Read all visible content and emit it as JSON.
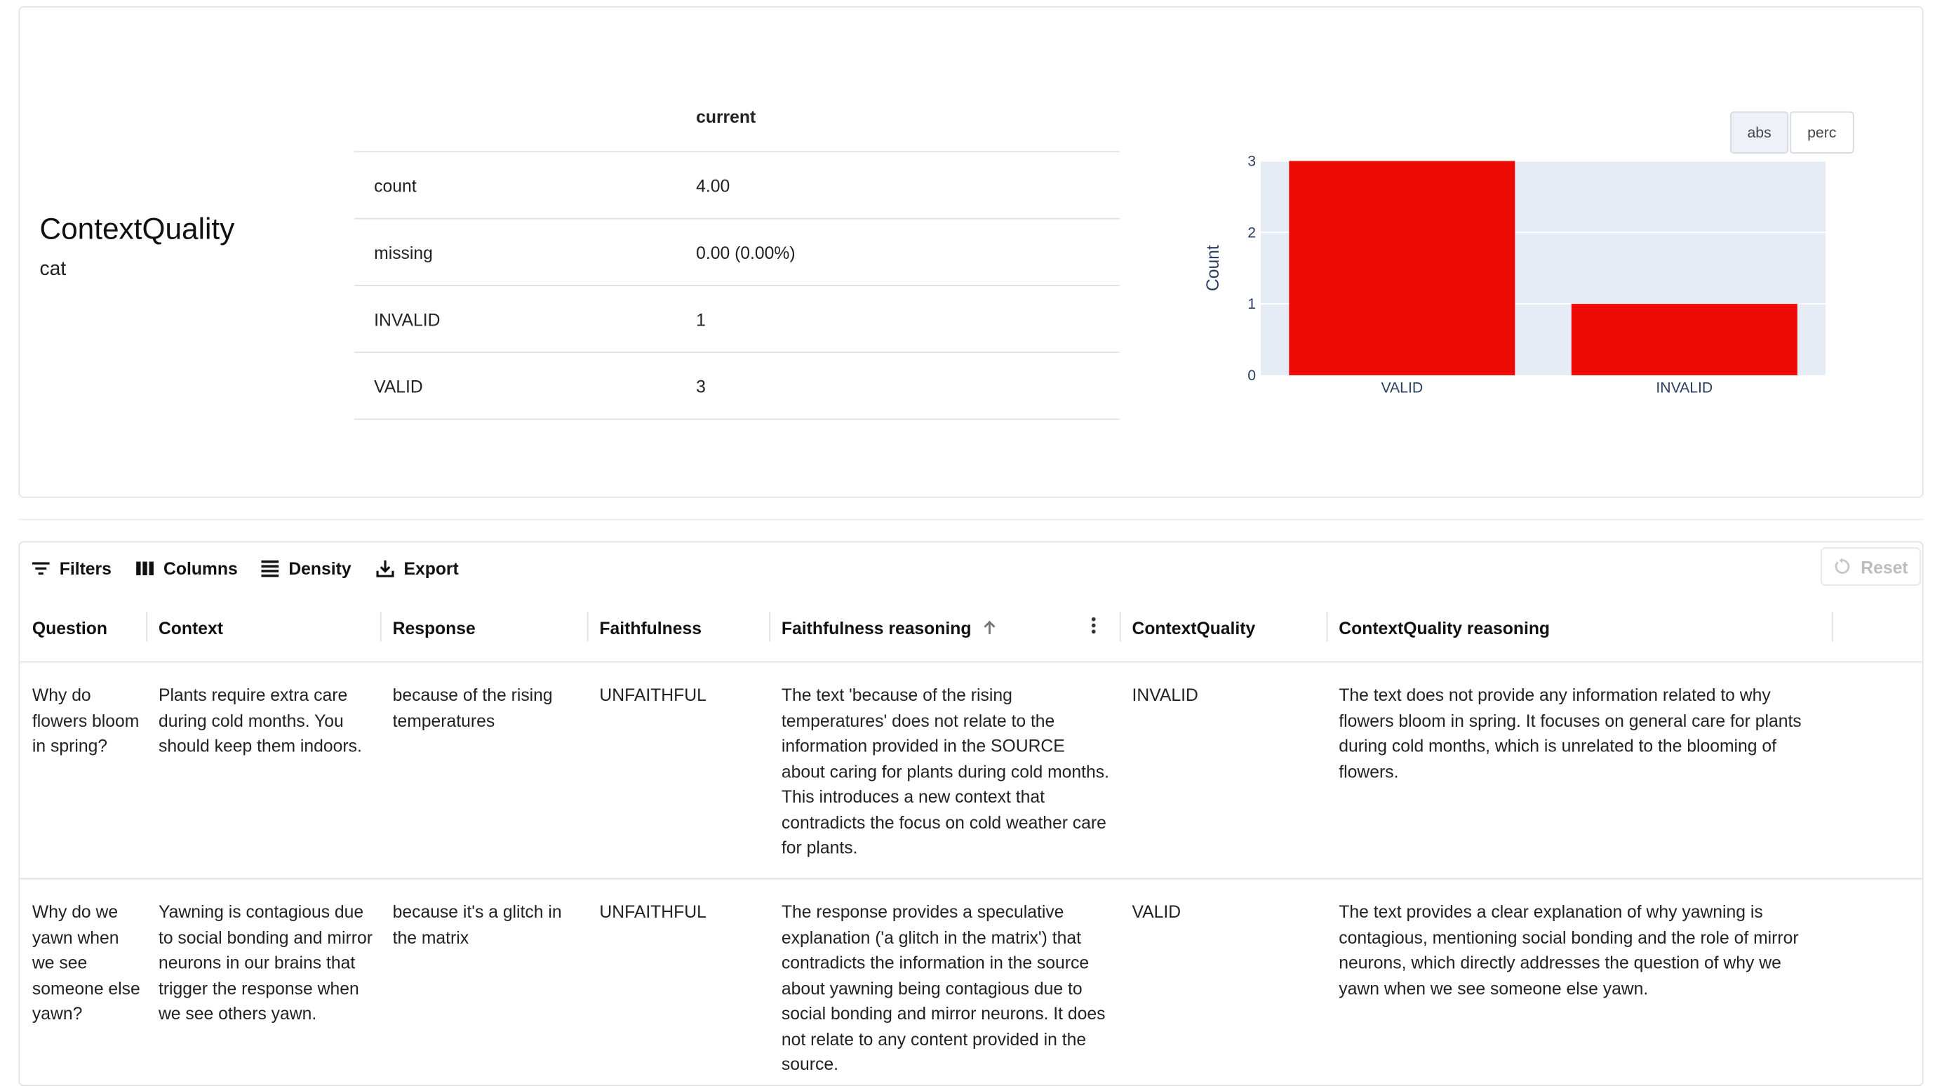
{
  "summary": {
    "feature_name": "ContextQuality",
    "feature_type": "cat",
    "stats_header": "current",
    "stats": [
      {
        "key": "count",
        "value": "4.00"
      },
      {
        "key": "missing",
        "value": "0.00 (0.00%)"
      },
      {
        "key": "INVALID",
        "value": "1"
      },
      {
        "key": "VALID",
        "value": "3"
      }
    ],
    "toggles": {
      "abs": "abs",
      "perc": "perc",
      "active": "abs"
    }
  },
  "chart_data": {
    "type": "bar",
    "categories": [
      "VALID",
      "INVALID"
    ],
    "values": [
      3,
      1
    ],
    "ylabel": "Count",
    "xlabel": "",
    "ylim": [
      0,
      3
    ],
    "yticks": [
      0,
      1,
      2,
      3
    ],
    "bar_color": "#ee0a05",
    "plot_bg": "#e5ecf6",
    "grid": true
  },
  "toolbar": {
    "filters": "Filters",
    "columns": "Columns",
    "density": "Density",
    "export": "Export",
    "reset": "Reset"
  },
  "table": {
    "columns": [
      "Question",
      "Context",
      "Response",
      "Faithfulness",
      "Faithfulness reasoning",
      "ContextQuality",
      "ContextQuality reasoning"
    ],
    "sorted_column": "Faithfulness reasoning",
    "rows": [
      {
        "Question": "Why do flowers bloom in spring?",
        "Context": "Plants require extra care during cold months. You should keep them indoors.",
        "Response": "because of the rising temperatures",
        "Faithfulness": "UNFAITHFUL",
        "Faithfulness reasoning": "The text 'because of the rising temperatures' does not relate to the information provided in the SOURCE about caring for plants during cold months. This introduces a new context that contradicts the focus on cold weather care for plants.",
        "ContextQuality": "INVALID",
        "ContextQuality reasoning": "The text does not provide any information related to why flowers bloom in spring. It focuses on general care for plants during cold months, which is unrelated to the blooming of flowers."
      },
      {
        "Question": "Why do we yawn when we see someone else yawn?",
        "Context": "Yawning is contagious due to social bonding and mirror neurons in our brains that trigger the response when we see others yawn.",
        "Response": "because it's a glitch in the matrix",
        "Faithfulness": "UNFAITHFUL",
        "Faithfulness reasoning": "The response provides a speculative explanation ('a glitch in the matrix') that contradicts the information in the source about yawning being contagious due to social bonding and mirror neurons. It does not relate to any content provided in the source.",
        "ContextQuality": "VALID",
        "ContextQuality reasoning": "The text provides a clear explanation of why yawning is contagious, mentioning social bonding and the role of mirror neurons, which directly addresses the question of why we yawn when we see someone else yawn."
      }
    ]
  }
}
